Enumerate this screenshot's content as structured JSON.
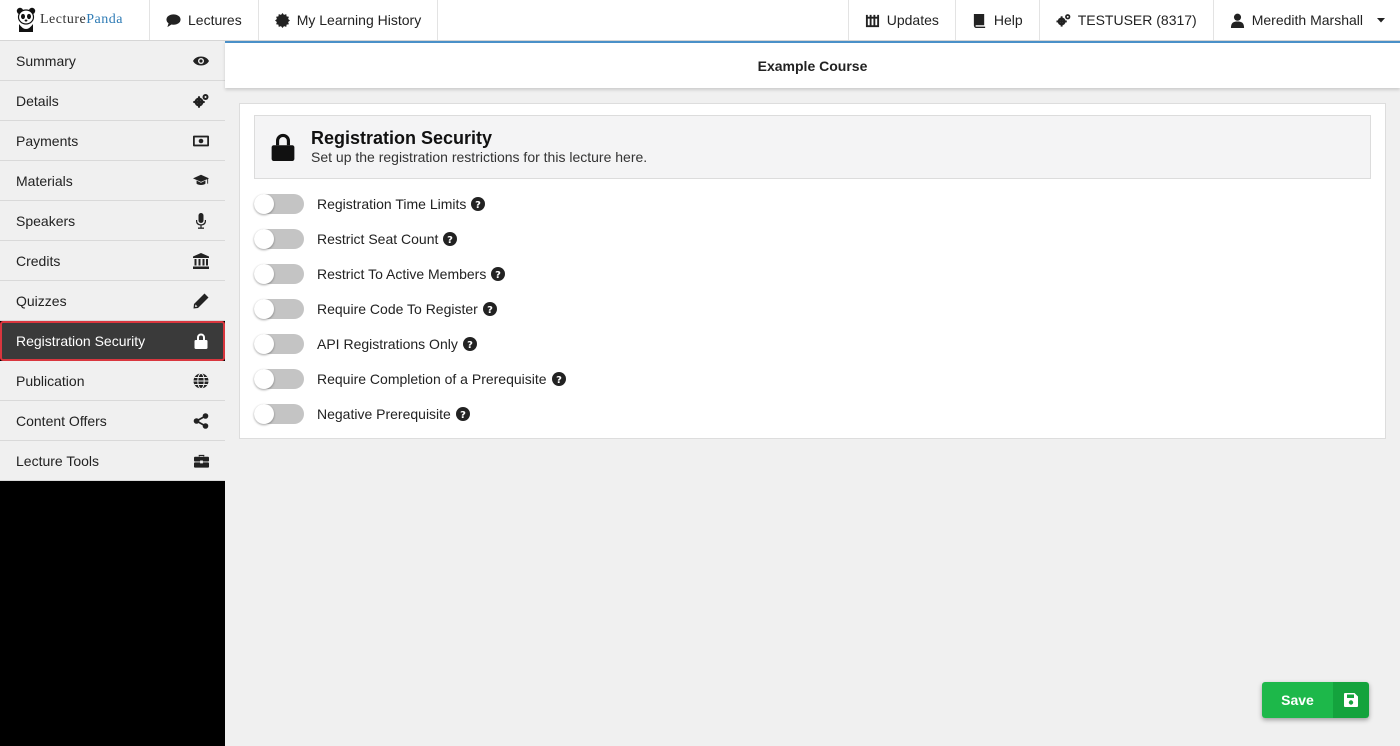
{
  "brand": {
    "lecture": "Lecture",
    "panda": "Panda"
  },
  "topnav": {
    "lectures": "Lectures",
    "history": "My Learning History",
    "updates": "Updates",
    "help": "Help",
    "account": "TESTUSER (8317)",
    "user": "Meredith Marshall"
  },
  "sidebar": {
    "items": [
      {
        "label": "Summary",
        "icon": "eye-icon"
      },
      {
        "label": "Details",
        "icon": "gears-icon"
      },
      {
        "label": "Payments",
        "icon": "money-icon"
      },
      {
        "label": "Materials",
        "icon": "graduation-cap-icon"
      },
      {
        "label": "Speakers",
        "icon": "microphone-icon"
      },
      {
        "label": "Credits",
        "icon": "institution-icon"
      },
      {
        "label": "Quizzes",
        "icon": "pencil-icon"
      },
      {
        "label": "Registration Security",
        "icon": "lock-icon",
        "active": true
      },
      {
        "label": "Publication",
        "icon": "globe-icon"
      },
      {
        "label": "Content Offers",
        "icon": "share-icon"
      },
      {
        "label": "Lecture Tools",
        "icon": "briefcase-icon"
      }
    ]
  },
  "course": {
    "title": "Example Course"
  },
  "panel": {
    "title": "Registration Security",
    "subtitle": "Set up the registration restrictions for this lecture here.",
    "options": [
      {
        "label": "Registration Time Limits",
        "enabled": false
      },
      {
        "label": "Restrict Seat Count",
        "enabled": false
      },
      {
        "label": "Restrict To Active Members",
        "enabled": false
      },
      {
        "label": "Require Code To Register",
        "enabled": false
      },
      {
        "label": "API Registrations Only",
        "enabled": false
      },
      {
        "label": "Require Completion of a Prerequisite",
        "enabled": false
      },
      {
        "label": "Negative Prerequisite",
        "enabled": false
      }
    ]
  },
  "actions": {
    "save": "Save"
  },
  "colors": {
    "accent": "#4a90c8",
    "save": "#1db84a",
    "active_border": "#d9363e"
  }
}
